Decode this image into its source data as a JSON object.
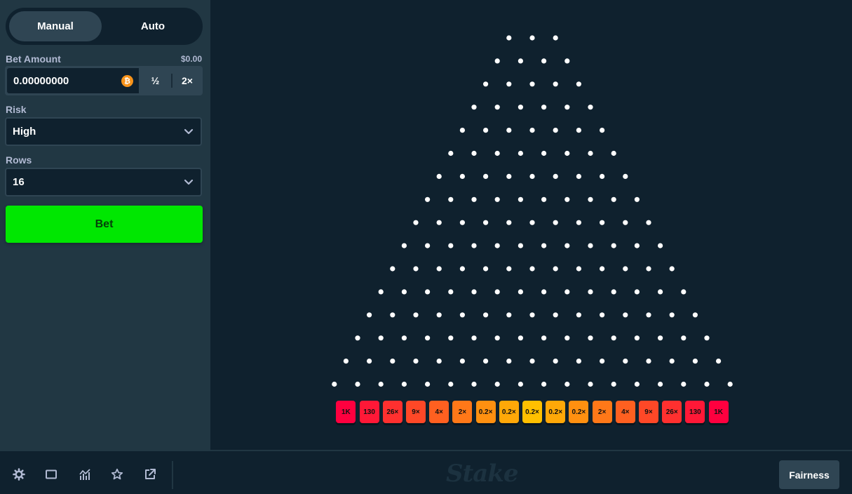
{
  "sidebar": {
    "mode_tabs": [
      {
        "label": "Manual",
        "active": true
      },
      {
        "label": "Auto",
        "active": false
      }
    ],
    "bet_amount": {
      "label": "Bet Amount",
      "usd_value": "$0.00",
      "value": "0.00000000",
      "currency_icon": "bitcoin-icon",
      "half_label": "½",
      "double_label": "2×"
    },
    "risk": {
      "label": "Risk",
      "value": "High"
    },
    "rows": {
      "label": "Rows",
      "value": "16"
    },
    "bet_button_label": "Bet"
  },
  "board": {
    "rows": 16,
    "peg_color": "#ffffff",
    "multipliers": [
      {
        "label": "1K",
        "color": "#ff003f"
      },
      {
        "label": "130",
        "color": "#ff1837"
      },
      {
        "label": "26×",
        "color": "#ff302f"
      },
      {
        "label": "9×",
        "color": "#ff4827"
      },
      {
        "label": "4×",
        "color": "#ff6020"
      },
      {
        "label": "2×",
        "color": "#ff7818"
      },
      {
        "label": "0.2×",
        "color": "#ff9010"
      },
      {
        "label": "0.2×",
        "color": "#ffa808"
      },
      {
        "label": "0.2×",
        "color": "#ffc000"
      },
      {
        "label": "0.2×",
        "color": "#ffa808"
      },
      {
        "label": "0.2×",
        "color": "#ff9010"
      },
      {
        "label": "2×",
        "color": "#ff7818"
      },
      {
        "label": "4×",
        "color": "#ff6020"
      },
      {
        "label": "9×",
        "color": "#ff4827"
      },
      {
        "label": "26×",
        "color": "#ff302f"
      },
      {
        "label": "130",
        "color": "#ff1837"
      },
      {
        "label": "1K",
        "color": "#ff003f"
      }
    ]
  },
  "footer": {
    "icons": [
      "gear-icon",
      "square-icon",
      "chart-icon",
      "star-icon",
      "external-link-icon"
    ],
    "logo_text": "Stake",
    "fairness_label": "Fairness"
  },
  "colors": {
    "sidebar_bg": "#213743",
    "game_bg": "#0f212e",
    "accent_green": "#00e701"
  }
}
